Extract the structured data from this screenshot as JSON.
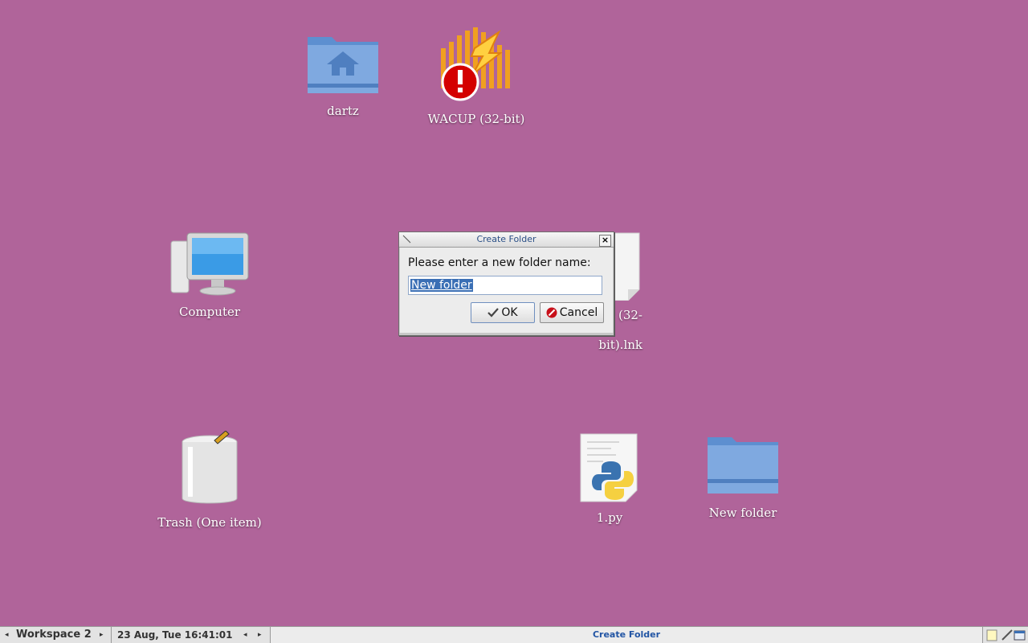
{
  "desktop": {
    "background": "#b0649a",
    "icons": [
      {
        "id": "dartz",
        "label": "dartz",
        "icon": "home-folder-icon"
      },
      {
        "id": "wacup",
        "label": "WACUP (32-bit)",
        "icon": "wacup-broken-shortcut-icon"
      },
      {
        "id": "computer",
        "label": "Computer",
        "icon": "computer-icon"
      },
      {
        "id": "wacup_lnk",
        "label": "WACUP (32-bit).lnk",
        "label_visible": "P (32-\nbit).lnk",
        "icon": "file-icon"
      },
      {
        "id": "trash",
        "label": "Trash (One item)",
        "icon": "trash-icon"
      },
      {
        "id": "py",
        "label": "1.py",
        "icon": "python-file-icon"
      },
      {
        "id": "new_folder",
        "label": "New folder",
        "icon": "folder-icon"
      }
    ]
  },
  "dialog": {
    "title": "Create Folder",
    "prompt": "Please enter a new folder name:",
    "input_value": "New folder",
    "ok_label": "OK",
    "cancel_label": "Cancel"
  },
  "taskbar": {
    "workspace": "Workspace 2",
    "clock": "23 Aug, Tue 16:41:01",
    "active_task": "Create Folder"
  }
}
